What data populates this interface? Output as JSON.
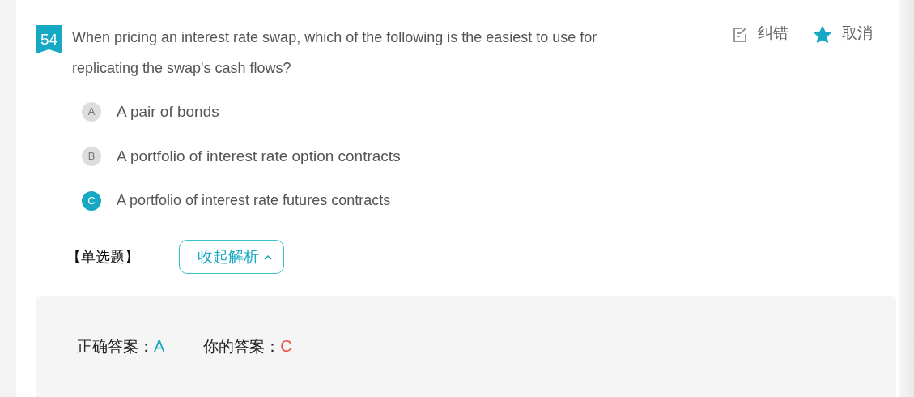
{
  "question": {
    "number": "54",
    "text": "When pricing an interest rate swap, which of the following is the easiest to use for replicating the swap's cash flows?"
  },
  "actions": [
    {
      "kind": "report",
      "label": "纠错"
    },
    {
      "kind": "favorite",
      "label": "取消",
      "on": true
    }
  ],
  "options": [
    {
      "letter": "A",
      "text": "A pair of bonds",
      "selected": false
    },
    {
      "letter": "B",
      "text": "A portfolio of interest rate option contracts",
      "selected": false
    },
    {
      "letter": "C",
      "text": "A portfolio of interest rate futures contracts",
      "selected": true
    }
  ],
  "question_type": "【单选题】",
  "toggle_button": {
    "label": "收起解析"
  },
  "answer": {
    "correct_label": "正确答案：",
    "correct": "A",
    "yours_label": "你的答案：",
    "yours": "C"
  }
}
